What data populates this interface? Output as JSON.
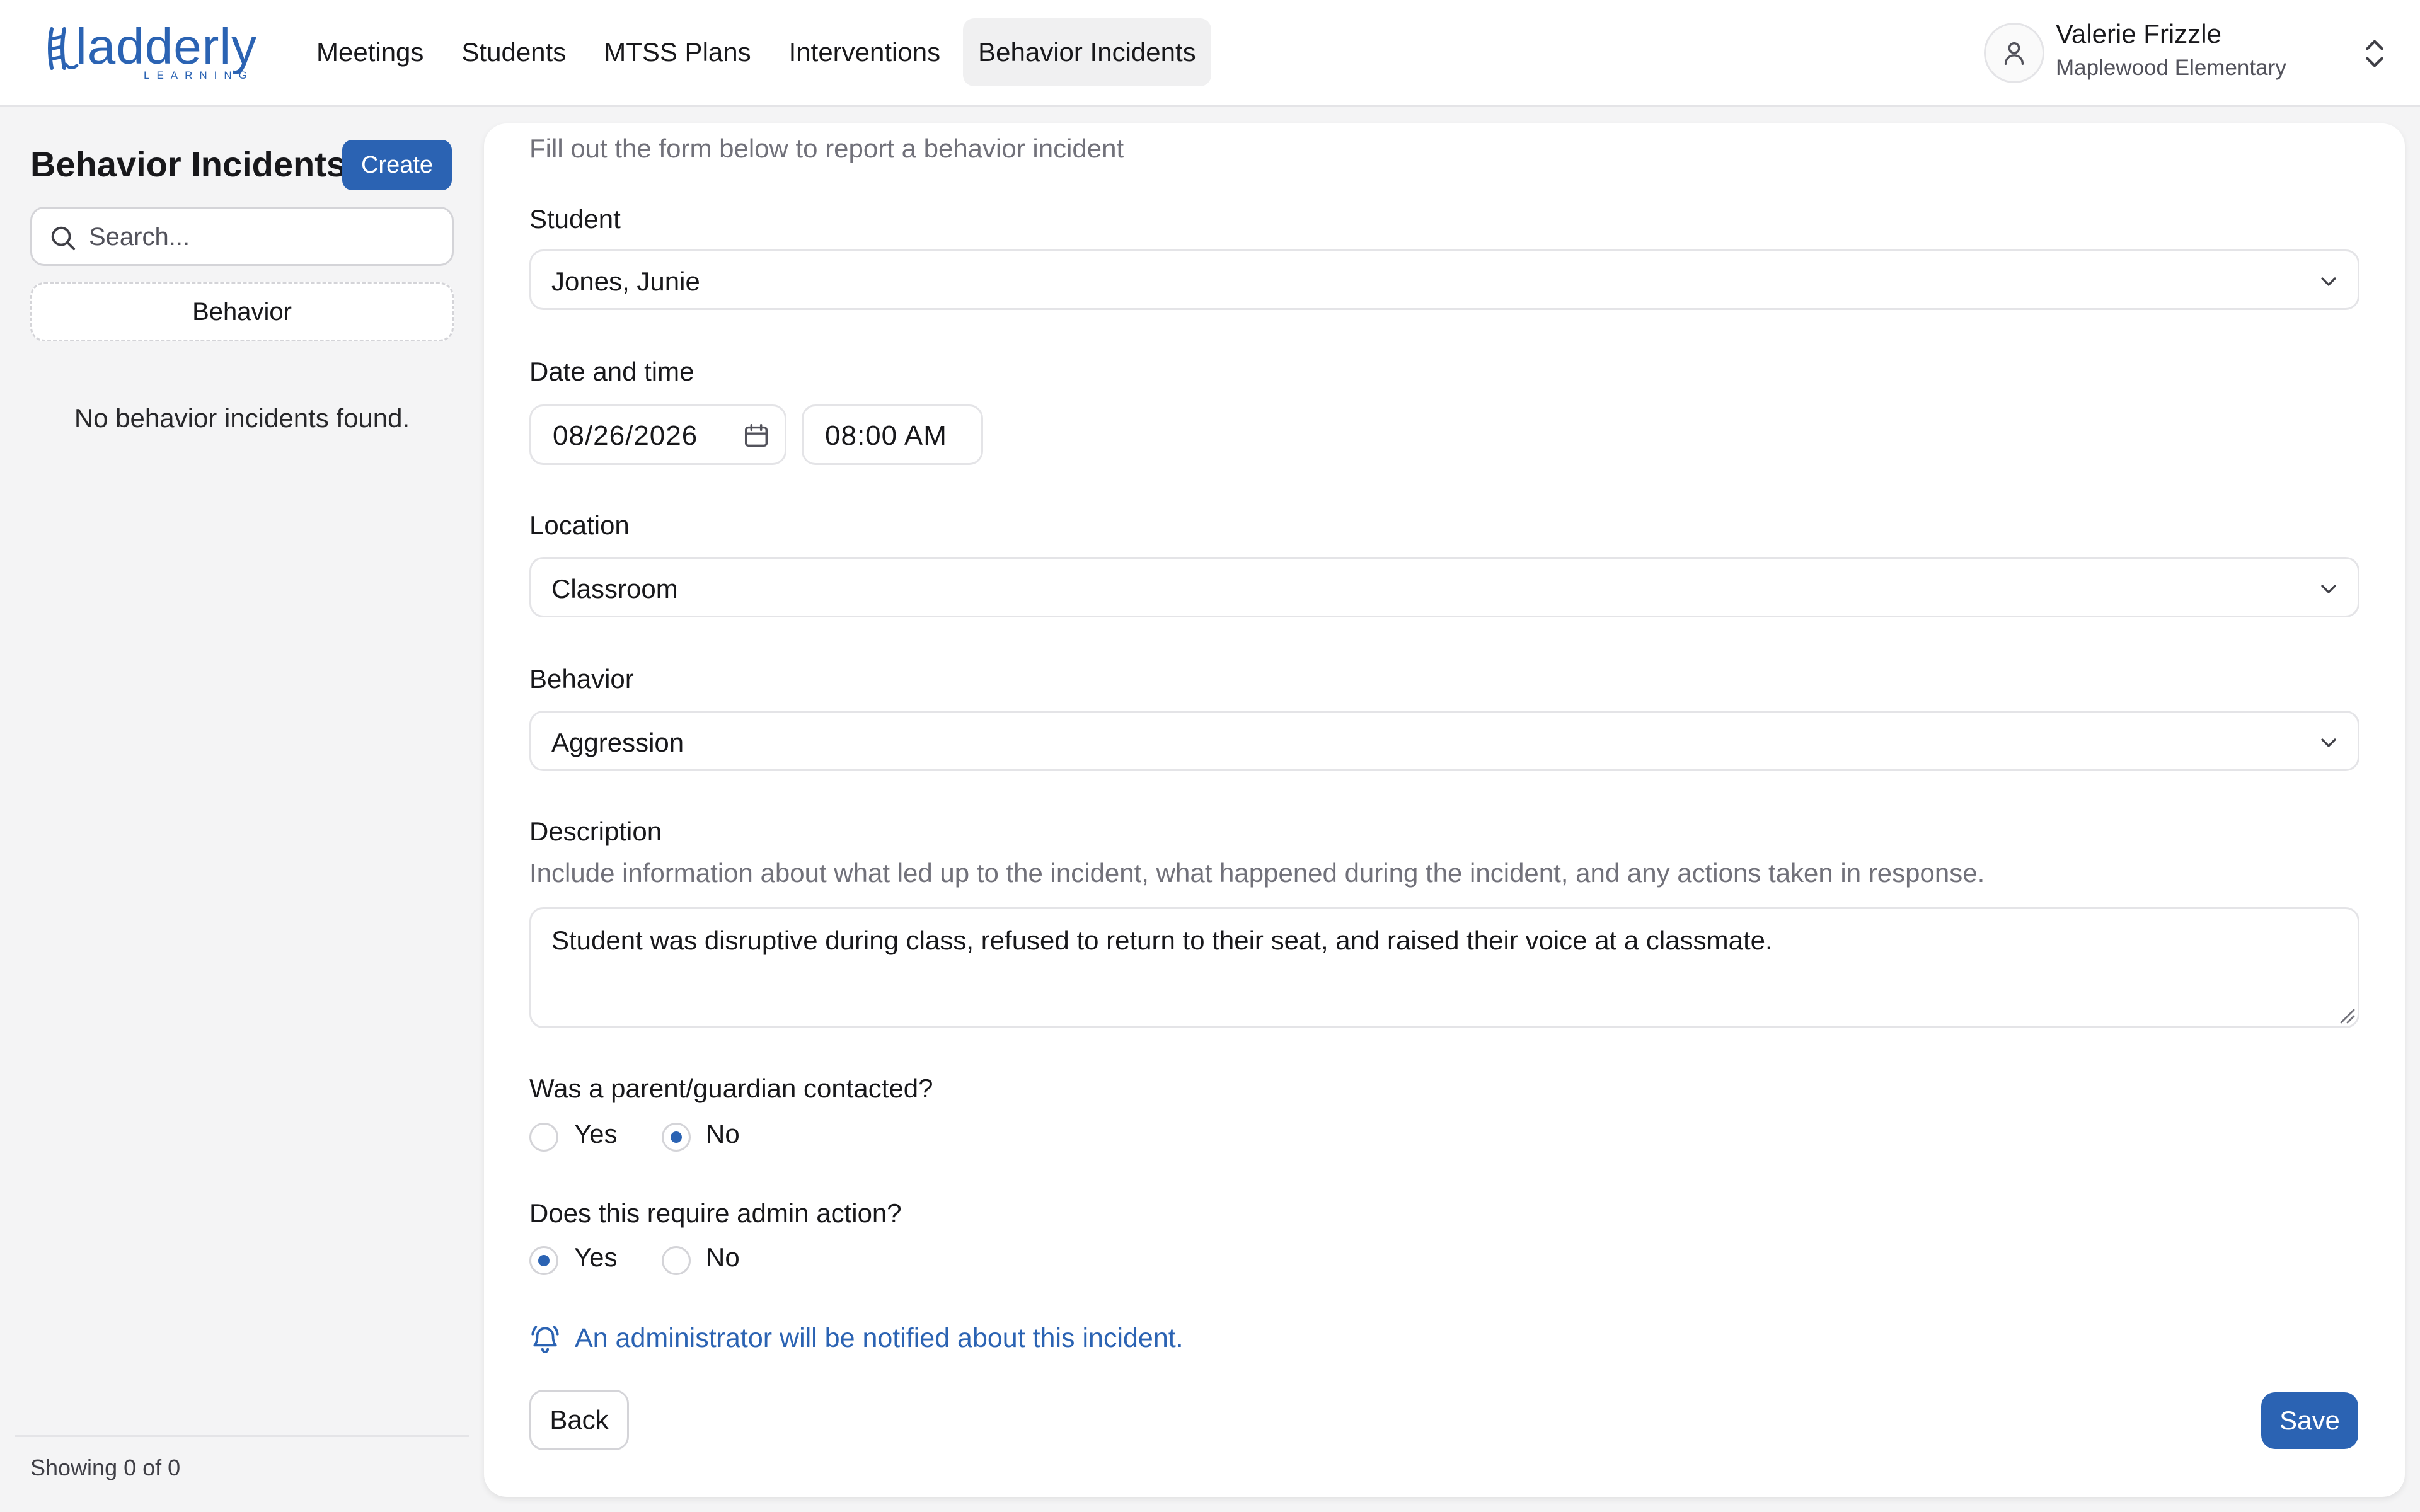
{
  "brand": {
    "name": "ladderly",
    "tagline": "LEARNING",
    "color": "#2b63b3"
  },
  "nav": {
    "items": [
      {
        "label": "Meetings"
      },
      {
        "label": "Students"
      },
      {
        "label": "MTSS Plans"
      },
      {
        "label": "Interventions"
      },
      {
        "label": "Behavior Incidents",
        "active": true
      }
    ]
  },
  "user": {
    "name": "Valerie Frizzle",
    "school": "Maplewood Elementary"
  },
  "sidebar": {
    "title": "Behavior Incidents",
    "create_label": "Create",
    "search_placeholder": "Search...",
    "filter_label": "Behavior",
    "empty_message": "No behavior incidents found.",
    "footer": "Showing 0 of 0"
  },
  "form": {
    "subtitle": "Fill out the form below to report a behavior incident",
    "student": {
      "label": "Student",
      "value": "Jones, Junie"
    },
    "datetime": {
      "label": "Date and time",
      "date": "08/26/2026",
      "time": "08:00  AM"
    },
    "location": {
      "label": "Location",
      "value": "Classroom"
    },
    "behavior": {
      "label": "Behavior",
      "value": "Aggression"
    },
    "description": {
      "label": "Description",
      "help": "Include information about what led up to the incident, what happened during the incident, and any actions taken in response.",
      "value": "Student was disruptive during class, refused to return to their seat, and raised their voice at a classmate."
    },
    "parent_contacted": {
      "question": "Was a parent/guardian contacted?",
      "yes": "Yes",
      "no": "No",
      "selected": "No"
    },
    "admin_action": {
      "question": "Does this require admin action?",
      "yes": "Yes",
      "no": "No",
      "selected": "Yes"
    },
    "notice": "An administrator will be notified about this incident.",
    "back_label": "Back",
    "save_label": "Save"
  }
}
